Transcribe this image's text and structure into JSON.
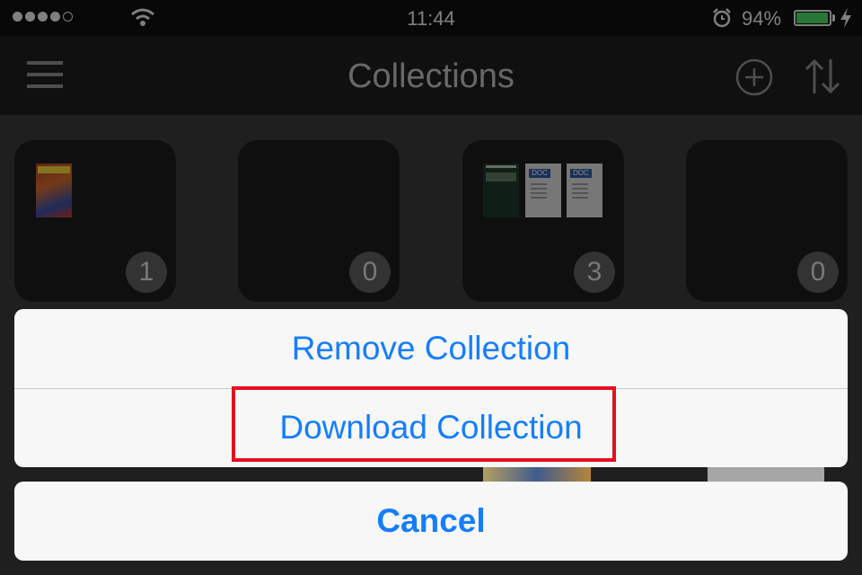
{
  "status_bar": {
    "time": "11:44",
    "battery_percent": "94%",
    "battery_level": 0.94,
    "signal_bars_filled": 4,
    "signal_bars_total": 5,
    "icons": [
      "signal-dots-icon",
      "wifi-icon",
      "alarm-icon",
      "battery-icon",
      "charging-bolt-icon"
    ]
  },
  "nav": {
    "title": "Collections",
    "icons": [
      "menu-icon",
      "add-icon",
      "sort-icon"
    ]
  },
  "collections": [
    {
      "count": "1",
      "thumbs": [
        "superheroes-cover"
      ]
    },
    {
      "count": "0",
      "thumbs": []
    },
    {
      "count": "3",
      "thumbs": [
        "book-cover",
        "doc",
        "doc"
      ]
    },
    {
      "count": "0",
      "thumbs": []
    }
  ],
  "doc_label": "DOC",
  "action_sheet": {
    "actions": [
      {
        "label": "Remove Collection"
      },
      {
        "label": "Download Collection",
        "highlighted": true
      }
    ],
    "cancel_label": "Cancel"
  },
  "colors": {
    "accent": "#157efb",
    "highlight_border": "#e3101f",
    "battery": "#4cd964"
  }
}
